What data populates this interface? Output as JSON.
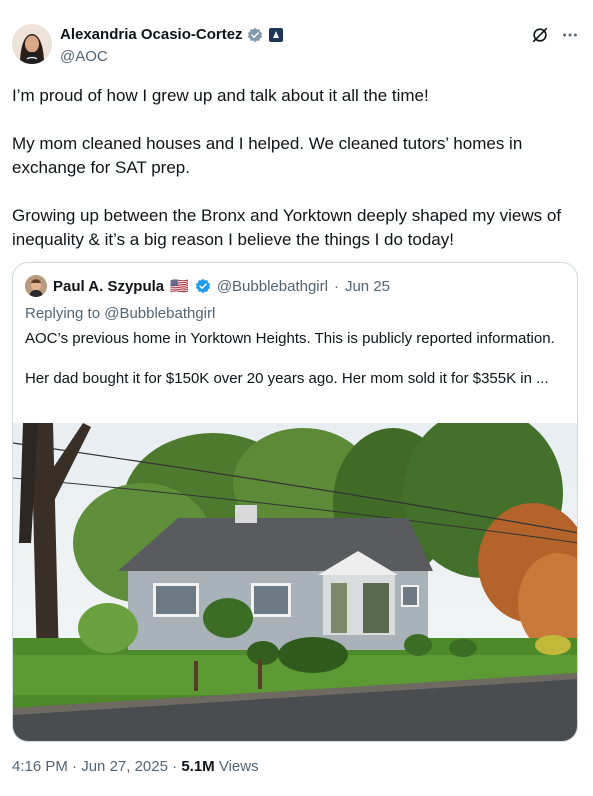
{
  "author": {
    "display_name": "Alexandria Ocasio-Cortez",
    "handle": "@AOC",
    "verified_badge_color": "#829aab",
    "avatar_icon": "profile-photo"
  },
  "tweet": {
    "paragraphs": [
      "I’m proud of how I grew up and talk about it all the time!",
      "My mom cleaned houses and I helped. We cleaned tutors’ homes in exchange for SAT prep.",
      "Growing up between the Bronx and Yorktown deeply shaped my views of inequality & it’s a big reason I believe the things I do today!"
    ]
  },
  "quote": {
    "display_name": "Paul A. Szypula",
    "flag": "🇺🇸",
    "handle": "@Bubblebathgirl",
    "separator": "·",
    "date": "Jun 25",
    "replying_to": "Replying to @Bubblebathgirl",
    "paragraphs": [
      "AOC’s previous home in Yorktown Heights. This is publicly reported information.",
      "Her dad bought it for $150K over 20 years ago. Her mom sold it for $355K in ..."
    ],
    "verified_badge_color": "#1d9bf0",
    "image_icon": "house-photo"
  },
  "footer": {
    "time": "4:16 PM",
    "separator": " · ",
    "date": "Jun 27, 2025",
    "views_count": "5.1M",
    "views_label": " Views"
  },
  "colors": {
    "text_primary": "#0f1419",
    "text_secondary": "#536471",
    "border": "#cfd9de"
  }
}
